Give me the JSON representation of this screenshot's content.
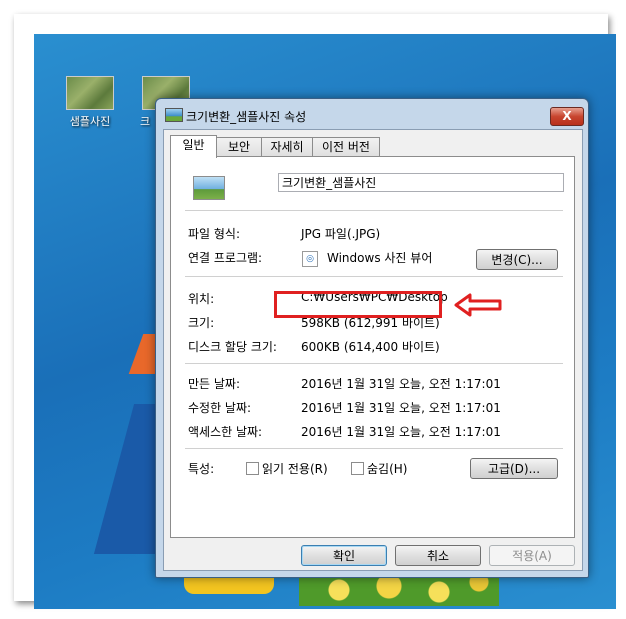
{
  "desktop": {
    "icons": [
      {
        "label": "샘플사진"
      },
      {
        "label": "크"
      }
    ]
  },
  "window": {
    "title": "크기변환_샘플사진 속성",
    "close_glyph": "X",
    "tabs": [
      {
        "label": "일반",
        "active": true
      },
      {
        "label": "보안"
      },
      {
        "label": "자세히"
      },
      {
        "label": "이전 버전"
      }
    ],
    "general": {
      "name_value": "크기변환_샘플사진",
      "file_type_label": "파일 형식:",
      "file_type_value": "JPG 파일(.JPG)",
      "opens_with_label": "연결 프로그램:",
      "opens_with_value": "Windows 사진 뷰어",
      "change_button": "변경(C)...",
      "location_label": "위치:",
      "location_value": "C:₩Users₩PC₩Desktop",
      "size_label": "크기:",
      "size_value": "598KB (612,991 바이트)",
      "size_on_disk_label": "디스크 할당 크기:",
      "size_on_disk_value": "600KB (614,400 바이트)",
      "created_label": "만든 날짜:",
      "created_value": "2016년 1월 31일 오늘, 오전 1:17:01",
      "modified_label": "수정한 날짜:",
      "modified_value": "2016년 1월 31일 오늘, 오전 1:17:01",
      "accessed_label": "액세스한 날짜:",
      "accessed_value": "2016년 1월 31일 오늘, 오전 1:17:01",
      "attributes_label": "특성:",
      "readonly_label": "읽기 전용(R)",
      "hidden_label": "숨김(H)",
      "advanced_button": "고급(D)..."
    },
    "footer": {
      "ok_button": "확인",
      "cancel_button": "취소",
      "apply_button": "적용(A)"
    }
  },
  "annotation": {
    "highlight_color": "#e02020"
  }
}
